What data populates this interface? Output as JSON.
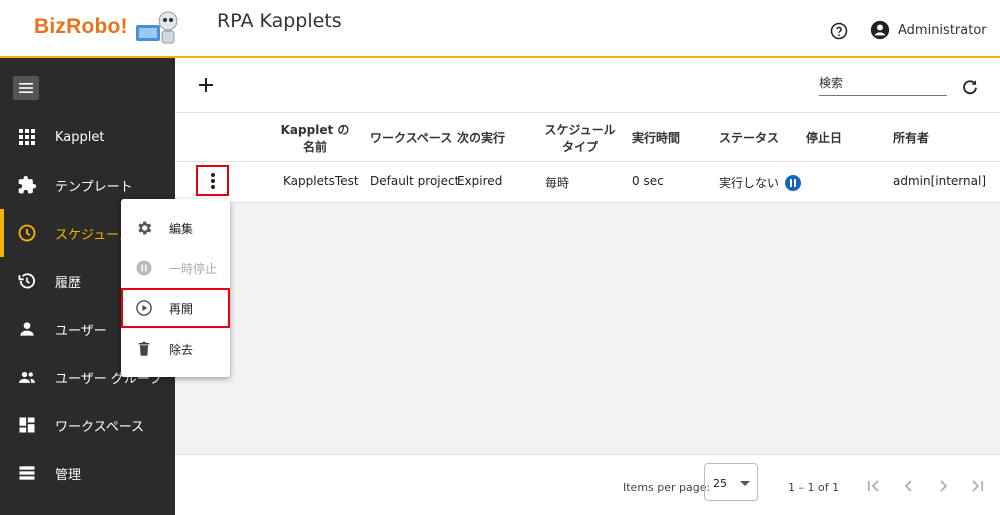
{
  "header": {
    "logo_text": "BizRobo!",
    "title": "RPA Kapplets",
    "user_name": "Administrator"
  },
  "sidebar": {
    "items": [
      {
        "label": "Kapplet",
        "icon": "grid-icon"
      },
      {
        "label": "テンプレート",
        "icon": "puzzle-icon"
      },
      {
        "label": "スケジュール",
        "icon": "clock-icon",
        "active": true
      },
      {
        "label": "履歴",
        "icon": "history-icon"
      },
      {
        "label": "ユーザー",
        "icon": "person-icon"
      },
      {
        "label": "ユーザー グループ",
        "icon": "people-icon"
      },
      {
        "label": "ワークスペース",
        "icon": "dashboard-icon"
      },
      {
        "label": "管理",
        "icon": "list-icon"
      }
    ]
  },
  "toolbar": {
    "search_placeholder": "検索"
  },
  "table": {
    "headers": {
      "name": "Kapplet の\n名前",
      "workspace": "ワークスペース",
      "next_run": "次の実行",
      "schedule_type": "スケジュール\nタイプ",
      "exec_time": "実行時間",
      "status": "ステータス",
      "stop_date": "停止日",
      "owner": "所有者"
    },
    "rows": [
      {
        "name": "KappletsTest",
        "workspace": "Default project",
        "next_run": "Expired",
        "schedule_type": "毎時",
        "exec_time": "0 sec",
        "status": "実行しない",
        "stop_date": "",
        "owner": "admin[internal]"
      }
    ]
  },
  "context_menu": {
    "items": [
      {
        "label": "編集",
        "icon": "gear-icon"
      },
      {
        "label": "一時停止",
        "icon": "pause-circle-icon",
        "disabled": true
      },
      {
        "label": "再開",
        "icon": "play-circle-icon"
      },
      {
        "label": "除去",
        "icon": "trash-icon"
      }
    ]
  },
  "paginator": {
    "items_per_page_label": "Items per page:",
    "page_size": "25",
    "range_label": "1 – 1 of 1"
  },
  "colors": {
    "accent": "#f5b400",
    "sidebar_bg": "#2b2b2b",
    "highlight_box": "#e60012",
    "status_icon": "#1565c0"
  }
}
